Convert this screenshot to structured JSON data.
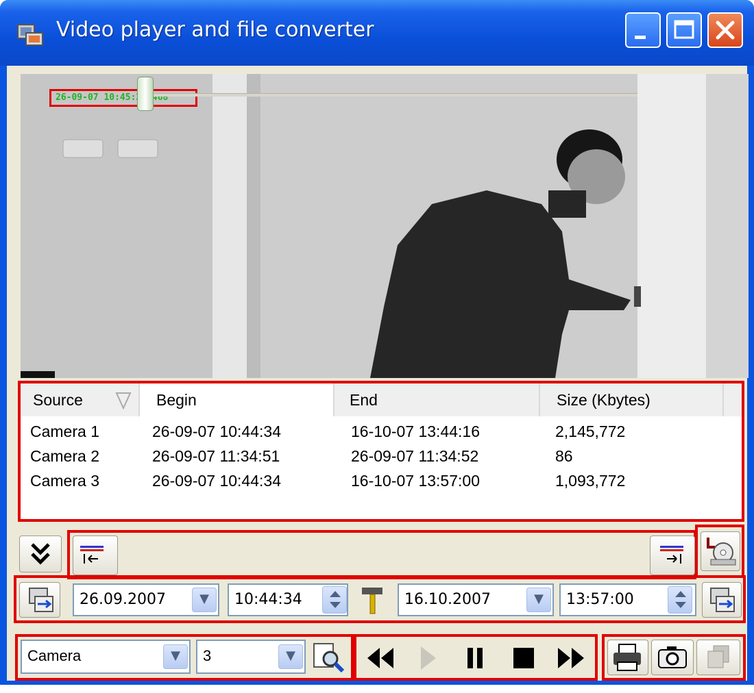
{
  "window": {
    "title": "Video player and file converter",
    "icon": "video-player-app-icon",
    "controls": [
      "minimize-icon",
      "maximize-icon",
      "close-icon"
    ]
  },
  "video": {
    "timestamp_overlay": "26-09-07 10:45:23:468"
  },
  "file_list": {
    "columns": [
      "Source",
      "Begin",
      "End",
      "Size (Kbytes)"
    ],
    "sort_indicator_icon": "sort-descending-icon",
    "rows": [
      {
        "source": "Camera 1",
        "begin": "26-09-07 10:44:34",
        "end": "16-10-07 13:44:16",
        "size": "2,145,772"
      },
      {
        "source": "Camera 2",
        "begin": "26-09-07 11:34:51",
        "end": "26-09-07 11:34:52",
        "size": "86"
      },
      {
        "source": "Camera 3",
        "begin": "26-09-07 10:44:34",
        "end": "16-10-07 13:57:00",
        "size": "1,093,772"
      }
    ]
  },
  "seek": {
    "collapse_icon": "double-chevron-down-icon",
    "start_icon": "go-to-start-marker-icon",
    "end_icon": "go-to-end-marker-icon",
    "export_icon": "export-to-disc-icon",
    "position": 0.0
  },
  "range": {
    "start_date": "26.09.2007",
    "start_time": "10:44:34",
    "end_date": "16.10.2007",
    "end_time": "13:57:00",
    "tool_icon": "hammer-icon",
    "left_apply_icon": "apply-range-icon",
    "right_apply_icon": "apply-range-icon"
  },
  "playback": {
    "source_type": "Camera",
    "source_number": "3",
    "search_icon": "zoom-search-icon",
    "buttons": [
      "rewind-icon",
      "play-icon",
      "pause-icon",
      "stop-icon",
      "fast-forward-icon"
    ],
    "tools": [
      "print-icon",
      "snapshot-camera-icon",
      "copy-icon"
    ]
  },
  "colors": {
    "highlight_red": "#e00000",
    "titlebar_blue": "#0a55e0",
    "osd_green": "#22b322"
  }
}
